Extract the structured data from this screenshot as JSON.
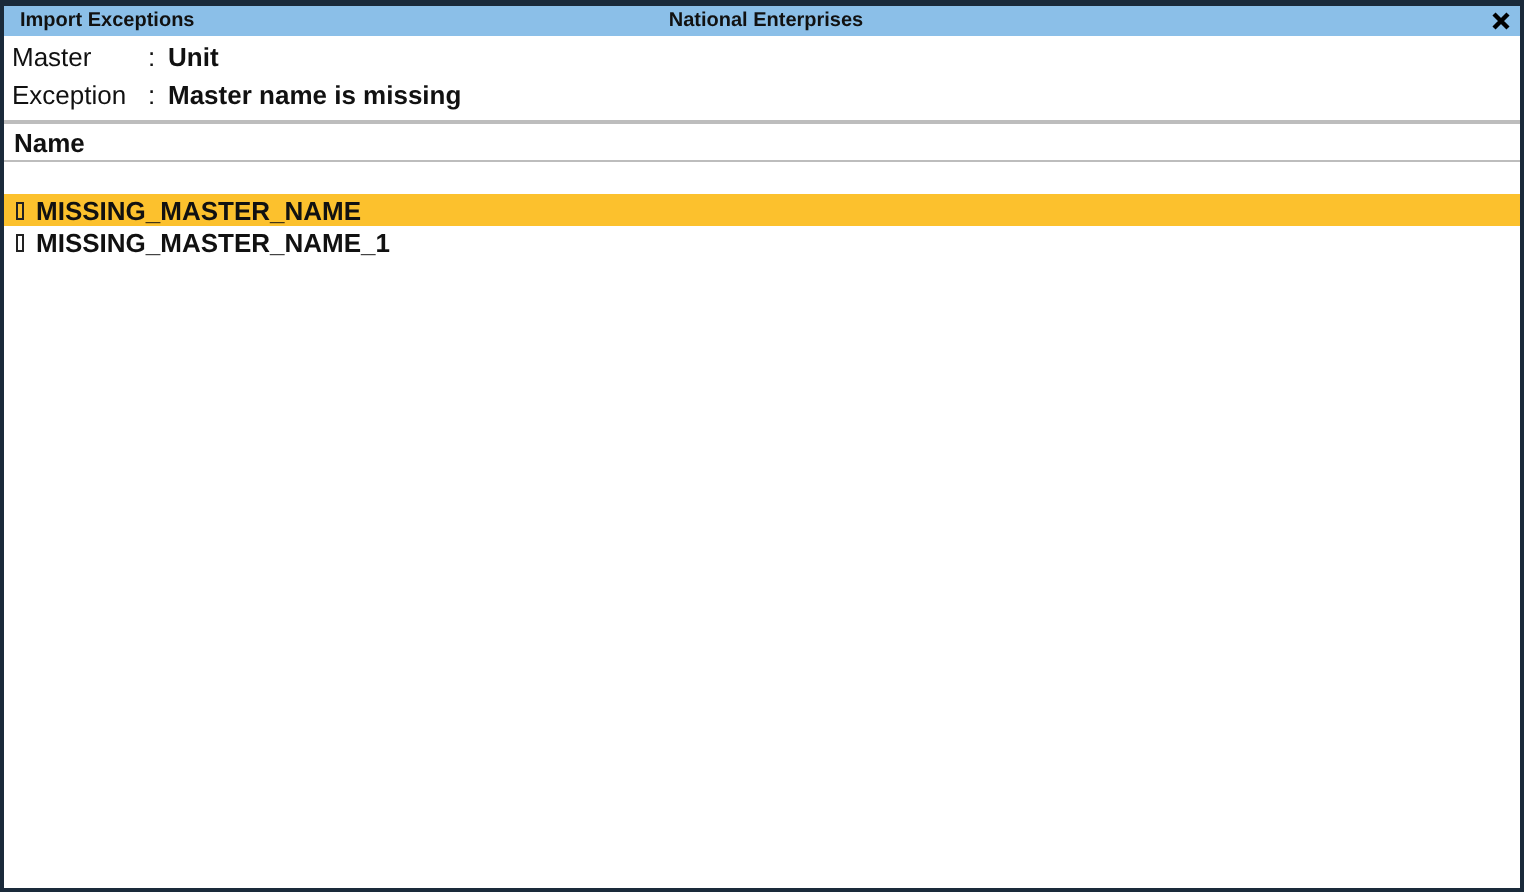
{
  "window": {
    "title": "Import Exceptions",
    "company": "National Enterprises"
  },
  "details": [
    {
      "label": "Master",
      "separator": ":",
      "value": "Unit"
    },
    {
      "label": "Exception",
      "separator": ":",
      "value": "Master name is missing"
    }
  ],
  "table": {
    "columns": [
      "Name"
    ],
    "rows": [
      {
        "name": "MISSING_MASTER_NAME",
        "selected": true
      },
      {
        "name": "MISSING_MASTER_NAME_1",
        "selected": false
      }
    ]
  }
}
